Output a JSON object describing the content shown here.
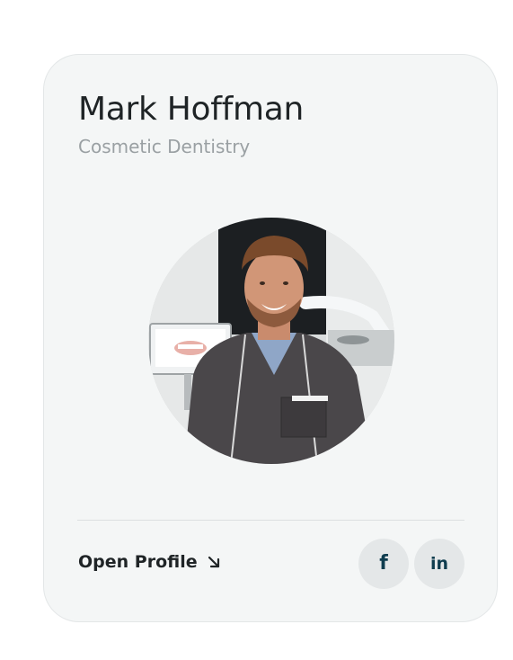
{
  "profile": {
    "name": "Mark Hoffman",
    "specialty": "Cosmetic Dentistry",
    "photo_alt": "Portrait of Mark Hoffman"
  },
  "actions": {
    "open_profile_label": "Open Profile",
    "open_profile_icon": "arrow-down-right-icon"
  },
  "social": [
    {
      "network": "facebook",
      "glyph": "f",
      "icon": "facebook-icon"
    },
    {
      "network": "linkedin",
      "glyph": "in",
      "icon": "linkedin-icon"
    }
  ],
  "colors": {
    "card_background": "#f4f6f6",
    "text_primary": "#1f2426",
    "text_secondary": "#9aa0a3",
    "social_icon": "#0f3d4f",
    "social_background": "#e4e7e8"
  }
}
